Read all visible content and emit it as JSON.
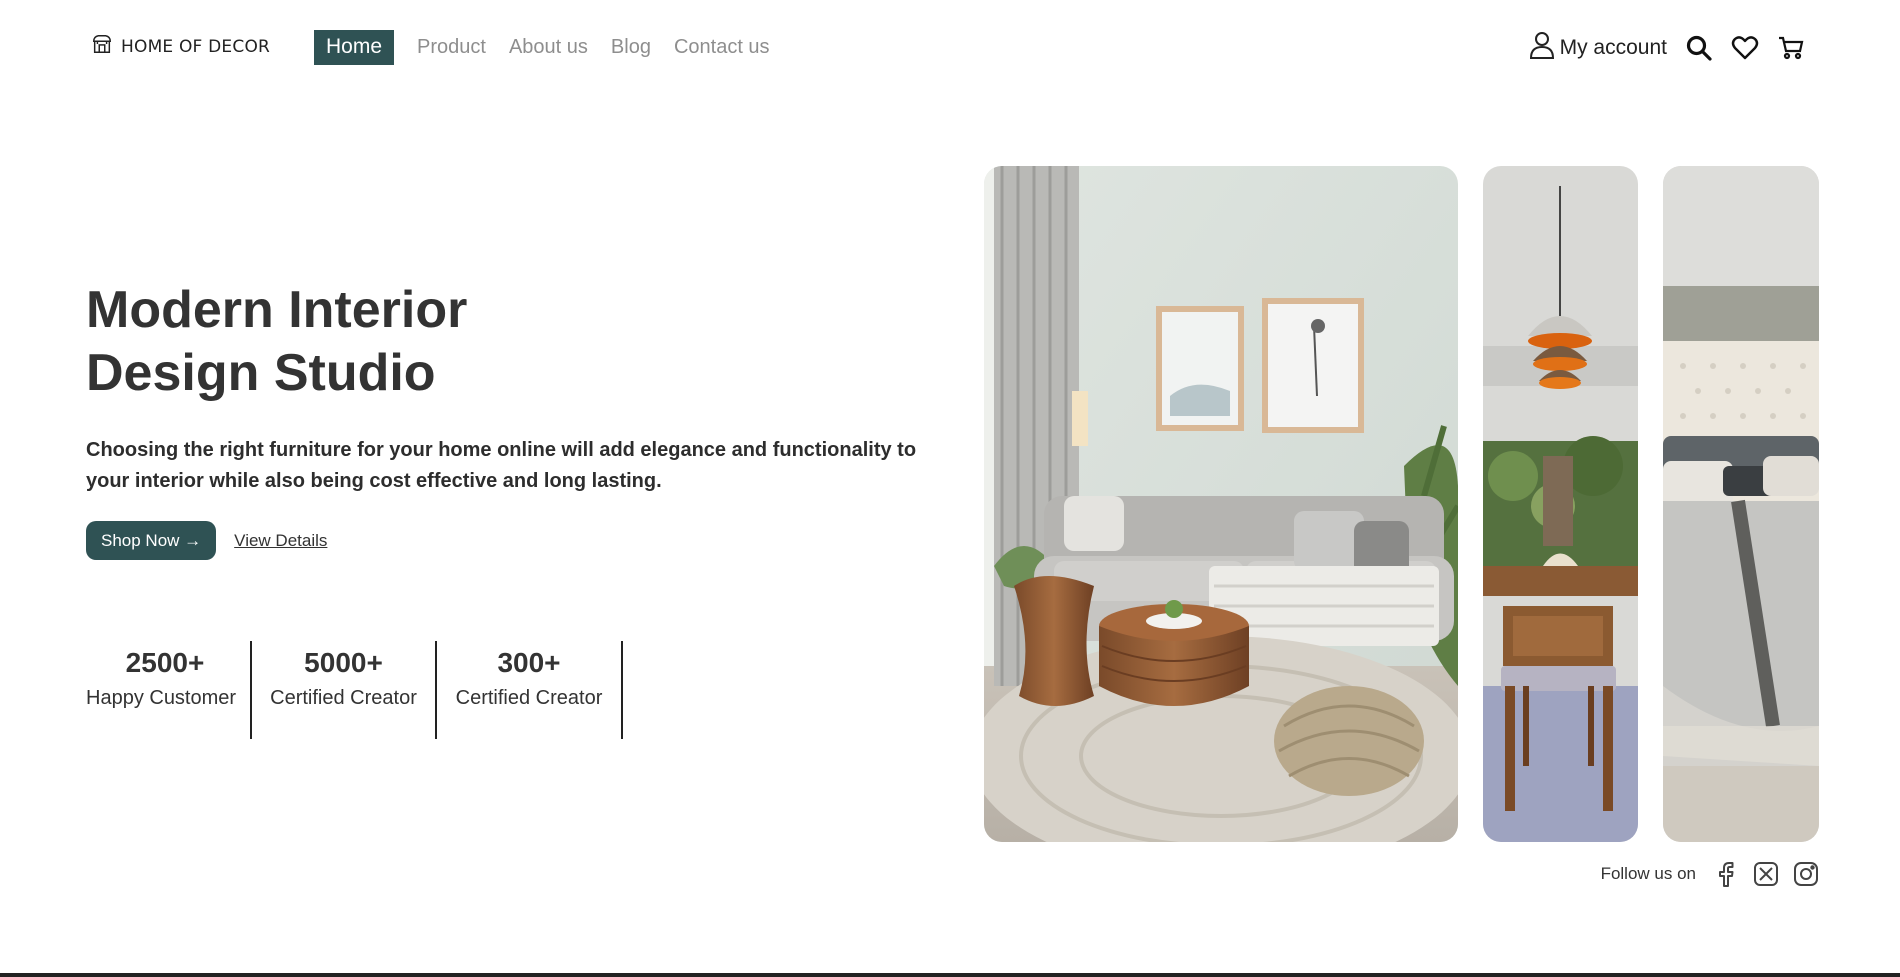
{
  "brand": {
    "name": "HOME OF DECOR",
    "logo_icon": "storefront-icon"
  },
  "nav": {
    "items": [
      {
        "label": "Home",
        "active": true
      },
      {
        "label": "Product",
        "active": false
      },
      {
        "label": "About us",
        "active": false
      },
      {
        "label": "Blog",
        "active": false
      },
      {
        "label": "Contact us",
        "active": false
      }
    ]
  },
  "header_actions": {
    "account_label": "My account",
    "icons": [
      "user-icon",
      "search-icon",
      "heart-icon",
      "cart-icon"
    ]
  },
  "hero": {
    "title_line1": "Modern Interior",
    "title_line2": "Design Studio",
    "description": "Choosing the right furniture for your home online will add elegance and functionality to your interior while also being cost effective and long lasting.",
    "primary_button": "Shop Now →",
    "secondary_link": "View Details"
  },
  "stats": [
    {
      "value": "2500+",
      "label": "Happy Customer"
    },
    {
      "value": "5000+",
      "label": "Certified Creator"
    },
    {
      "value": "300+",
      "label": "Certified Creator"
    }
  ],
  "follow": {
    "label": "Follow us on",
    "networks": [
      "facebook-icon",
      "x-twitter-icon",
      "instagram-icon"
    ]
  },
  "colors": {
    "accent": "#2f5254",
    "text": "#333333",
    "nav_inactive": "#8e8e8e"
  }
}
